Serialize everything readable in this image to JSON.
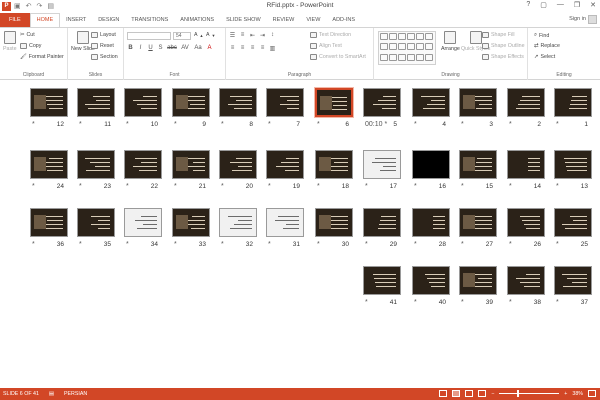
{
  "titlebar": {
    "title": "RFid.pptx - PowerPoint",
    "app_logo": "P",
    "qat": [
      "save-icon",
      "undo-icon",
      "redo-icon",
      "start-from-beginning-icon"
    ],
    "controls": [
      "?",
      "▢",
      "—",
      "❐",
      "✕"
    ]
  },
  "tabs": [
    "FILE",
    "HOME",
    "INSERT",
    "DESIGN",
    "TRANSITIONS",
    "ANIMATIONS",
    "SLIDE SHOW",
    "REVIEW",
    "VIEW",
    "ADD-INS"
  ],
  "active_tab": "HOME",
  "signin": "Sign in",
  "ribbon": {
    "clipboard": {
      "label": "Clipboard",
      "paste": "Paste",
      "cut": "Cut",
      "copy": "Copy",
      "format_painter": "Format Painter"
    },
    "slides": {
      "label": "Slides",
      "new_slide": "New Slide",
      "layout": "Layout",
      "reset": "Reset",
      "section": "Section"
    },
    "font": {
      "label": "Font",
      "font_name": "",
      "font_size": "54",
      "format_buttons": [
        "B",
        "I",
        "U",
        "S",
        "abc",
        "AV",
        "Aa",
        "A"
      ]
    },
    "paragraph": {
      "label": "Paragraph",
      "text_direction": "Text Direction",
      "align_text": "Align Text",
      "convert_smartart": "Convert to SmartArt"
    },
    "drawing": {
      "label": "Drawing",
      "arrange": "Arrange",
      "quick_styles": "Quick Styles",
      "shape_fill": "Shape Fill",
      "shape_outline": "Shape Outline",
      "shape_effects": "Shape Effects"
    },
    "editing": {
      "label": "Editing",
      "find": "Find",
      "replace": "Replace",
      "select": "Select"
    }
  },
  "slides": {
    "selected": 6,
    "rows": [
      [
        {
          "n": "12",
          "star": "*"
        },
        {
          "n": "11",
          "star": "*"
        },
        {
          "n": "10",
          "star": "*"
        },
        {
          "n": "9",
          "star": "*"
        },
        {
          "n": "8",
          "star": "*"
        },
        {
          "n": "7",
          "star": "*"
        },
        {
          "n": "6",
          "star": "*"
        },
        {
          "n": "5",
          "star": "00:10 *"
        },
        {
          "n": "4",
          "star": "*"
        },
        {
          "n": "3",
          "star": "*"
        },
        {
          "n": "2",
          "star": "*"
        },
        {
          "n": "1",
          "star": "*"
        }
      ],
      [
        {
          "n": "24",
          "star": "*"
        },
        {
          "n": "23",
          "star": "*"
        },
        {
          "n": "22",
          "star": "*"
        },
        {
          "n": "21",
          "star": "*"
        },
        {
          "n": "20",
          "star": "*"
        },
        {
          "n": "19",
          "star": "*"
        },
        {
          "n": "18",
          "star": "*"
        },
        {
          "n": "17",
          "star": "*"
        },
        {
          "n": "16",
          "star": "*"
        },
        {
          "n": "15",
          "star": "*"
        },
        {
          "n": "14",
          "star": "*"
        },
        {
          "n": "13",
          "star": "*"
        }
      ],
      [
        {
          "n": "36",
          "star": "*"
        },
        {
          "n": "35",
          "star": "*"
        },
        {
          "n": "34",
          "star": "*"
        },
        {
          "n": "33",
          "star": "*"
        },
        {
          "n": "32",
          "star": "*"
        },
        {
          "n": "31",
          "star": "*"
        },
        {
          "n": "30",
          "star": "*"
        },
        {
          "n": "29",
          "star": "*"
        },
        {
          "n": "28",
          "star": "*"
        },
        {
          "n": "27",
          "star": "*"
        },
        {
          "n": "26",
          "star": "*"
        },
        {
          "n": "25",
          "star": "*"
        }
      ],
      [
        {
          "n": "41",
          "star": "*"
        },
        {
          "n": "40",
          "star": "*"
        },
        {
          "n": "39",
          "star": "*"
        },
        {
          "n": "38",
          "star": "*"
        },
        {
          "n": "37",
          "star": "*"
        }
      ]
    ]
  },
  "status": {
    "slide_info": "SLIDE 6 OF 41",
    "language": "PERSIAN",
    "zoom": "38%",
    "zoom_minus": "−",
    "zoom_plus": "+"
  }
}
